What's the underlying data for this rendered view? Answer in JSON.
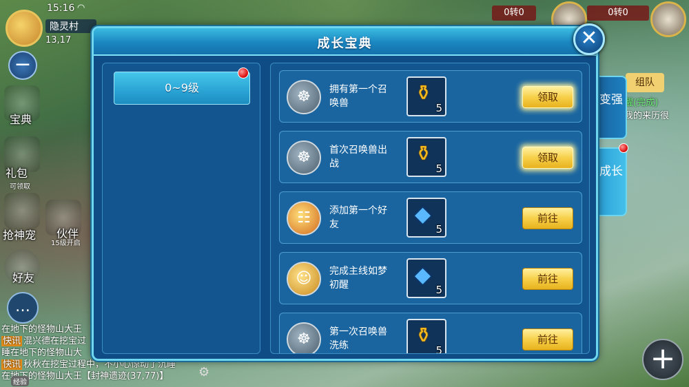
{
  "hud": {
    "time": "15:16",
    "location": "隐灵村",
    "coords": "13,17",
    "side_menu": [
      {
        "label": "宝典",
        "sub": ""
      },
      {
        "label": "礼包",
        "sub": "可领取"
      },
      {
        "label": "抢神宠",
        "sub": ""
      },
      {
        "label": "伙伴",
        "sub": "15级开启"
      },
      {
        "label": "好友",
        "sub": ""
      }
    ],
    "top_right": [
      {
        "text": "0转0"
      },
      {
        "text": "0转0"
      }
    ],
    "team_label": "组队",
    "quest": {
      "status": "醒(完成)",
      "desc": "我的来历很"
    },
    "exp_label": "经验"
  },
  "chat": {
    "lines": [
      {
        "tag": "",
        "text": "在地下的怪物山大王"
      },
      {
        "tag": "快讯",
        "text": "混兴德在挖宝过"
      },
      {
        "tag": "",
        "text": "睡在地下的怪物山大"
      },
      {
        "tag": "快讯",
        "text": "秋秋在挖宝过程中，不小心惊动了沉睡"
      },
      {
        "tag": "",
        "text": "在地下的怪物山大王【封神遗迹(37,77)】"
      }
    ]
  },
  "modal": {
    "title": "成长宝典",
    "close_label": "✕",
    "level_tab": "0~9级",
    "side_tabs": [
      {
        "label": "变强"
      },
      {
        "label": "成长"
      }
    ],
    "tasks": [
      {
        "text": "拥有第一个召唤兽",
        "reward_icon": "gourd-icon",
        "reward_count": "5",
        "button": "领取",
        "icon": "compass-medal-icon"
      },
      {
        "text": "首次召唤兽出战",
        "reward_icon": "gourd-icon",
        "reward_count": "5",
        "button": "领取",
        "icon": "compass-medal-icon"
      },
      {
        "text": "添加第一个好友",
        "reward_icon": "crystal-icon",
        "reward_count": "5",
        "button": "前往",
        "icon": "scroll-icon"
      },
      {
        "text": "完成主线如梦初醒",
        "reward_icon": "crystal-icon",
        "reward_count": "5",
        "button": "前往",
        "icon": "face-icon"
      },
      {
        "text": "第一次召唤兽洗练",
        "reward_icon": "gourd-icon",
        "reward_count": "5",
        "button": "前往",
        "icon": "compass-medal-icon"
      }
    ]
  },
  "colors": {
    "accent": "#6fd6ef",
    "button_gold": "#f7d04a",
    "panel": "#13558f"
  }
}
